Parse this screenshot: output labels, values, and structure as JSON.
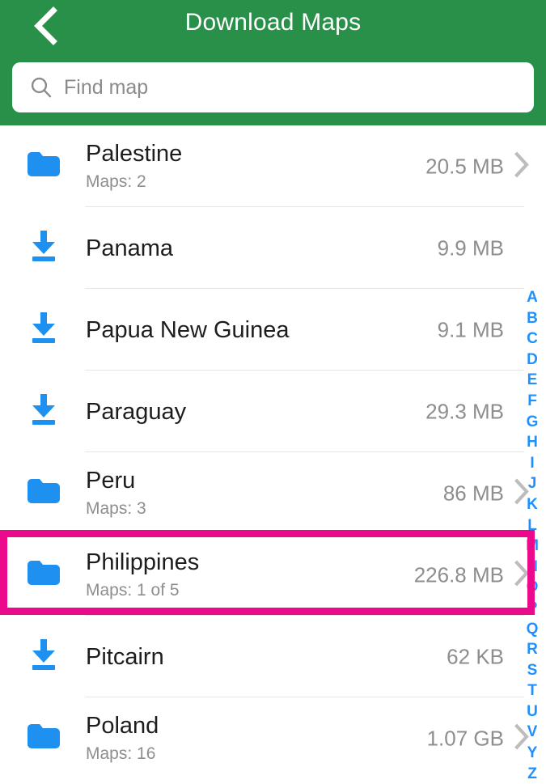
{
  "header": {
    "title": "Download Maps",
    "back_icon": "chevron-left-icon",
    "accent_color": "#289048"
  },
  "search": {
    "placeholder": "Find map",
    "value": "",
    "icon": "search-icon"
  },
  "list": {
    "folder_icon": "folder-icon",
    "download_icon": "download-icon",
    "chevron_icon": "chevron-right-icon",
    "items": [
      {
        "name": "Palestine",
        "sub": "Maps: 2",
        "size": "20.5 MB",
        "icon": "folder-icon",
        "chevron": true
      },
      {
        "name": "Panama",
        "sub": "",
        "size": "9.9 MB",
        "icon": "download-icon",
        "chevron": false
      },
      {
        "name": "Papua New Guinea",
        "sub": "",
        "size": "9.1 MB",
        "icon": "download-icon",
        "chevron": false
      },
      {
        "name": "Paraguay",
        "sub": "",
        "size": "29.3 MB",
        "icon": "download-icon",
        "chevron": false
      },
      {
        "name": "Peru",
        "sub": "Maps: 3",
        "size": "86 MB",
        "icon": "folder-icon",
        "chevron": true
      },
      {
        "name": "Philippines",
        "sub": "Maps: 1 of 5",
        "size": "226.8 MB",
        "icon": "folder-icon",
        "chevron": true
      },
      {
        "name": "Pitcairn",
        "sub": "",
        "size": "62 KB",
        "icon": "download-icon",
        "chevron": false
      },
      {
        "name": "Poland",
        "sub": "Maps: 16",
        "size": "1.07 GB",
        "icon": "folder-icon",
        "chevron": true
      }
    ]
  },
  "alpha_index": {
    "color": "#1e90ff",
    "letters": [
      "A",
      "B",
      "C",
      "D",
      "E",
      "F",
      "G",
      "H",
      "I",
      "J",
      "K",
      "L",
      "M",
      "N",
      "O",
      "P",
      "Q",
      "R",
      "S",
      "T",
      "U",
      "V",
      "Y",
      "Z"
    ]
  },
  "highlight": {
    "target": "Philippines",
    "color": "#ec0a8c"
  }
}
